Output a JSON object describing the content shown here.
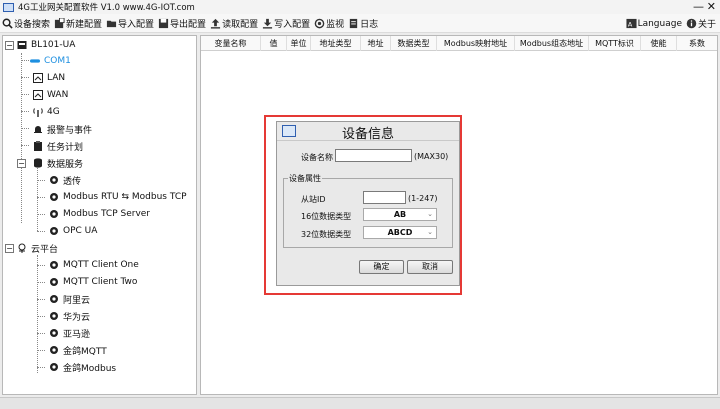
{
  "window": {
    "title": "4G工业网关配置软件 V1.0 www.4G-IOT.com",
    "minimize": "—",
    "close": "✕"
  },
  "toolbar": {
    "items": [
      "设备搜索",
      "新建配置",
      "导入配置",
      "导出配置",
      "读取配置",
      "写入配置",
      "监视",
      "日志"
    ],
    "language": "Language",
    "about": "关于"
  },
  "tree": {
    "root": "BL101-UA",
    "com1": "COM1",
    "lan": "LAN",
    "wan": "WAN",
    "g4": "4G",
    "alarm": "报警与事件",
    "task": "任务计划",
    "data_service": "数据服务",
    "passthrough": "透传",
    "modbus_rtu_tcp": "Modbus RTU ⇆ Modbus TCP",
    "modbus_tcp_server": "Modbus TCP Server",
    "opc_ua": "OPC UA",
    "cloud": "云平台",
    "mqtt_one": "MQTT Client One",
    "mqtt_two": "MQTT Client Two",
    "aliyun": "阿里云",
    "huawei": "华为云",
    "amazon": "亚马逊",
    "jinge_mqtt": "金鸽MQTT",
    "jinge_modbus": "金鸽Modbus"
  },
  "table": {
    "columns": [
      "变量名称",
      "值",
      "单位",
      "地址类型",
      "地址",
      "数据类型",
      "Modbus映射地址",
      "Modbus组态地址",
      "MQTT标识",
      "使能",
      "系数"
    ]
  },
  "dialog": {
    "title": "设备信息",
    "device_name_label": "设备名称",
    "device_name_value": "",
    "device_name_hint": "(MAX30)",
    "group_title": "设备属性",
    "slave_id_label": "从站ID",
    "slave_id_value": "",
    "slave_id_hint": "(1-247)",
    "type16_label": "16位数据类型",
    "type16_value": "AB",
    "type32_label": "32位数据类型",
    "type32_value": "ABCD",
    "ok_label": "确定",
    "cancel_label": "取消"
  },
  "colors": {
    "selected": "#1d8fe0",
    "highlight": "#e53935"
  }
}
